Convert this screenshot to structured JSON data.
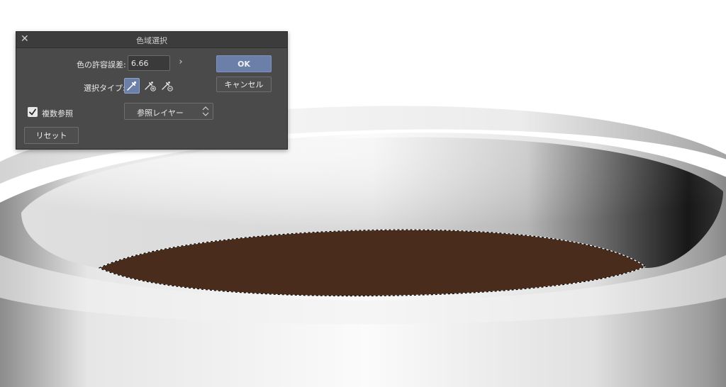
{
  "dialog": {
    "title": "色域選択",
    "tolerance_label": "色の許容誤差:",
    "tolerance_value": "6.66",
    "ok_label": "OK",
    "cancel_label": "キャンセル",
    "select_type_label": "選択タイプ:",
    "tools": [
      {
        "name": "new-selection",
        "icon": "eyedropper-icon",
        "active": true
      },
      {
        "name": "add-to-selection",
        "icon": "eyedropper-plus-icon",
        "active": false
      },
      {
        "name": "subtract-from-selection",
        "icon": "eyedropper-minus-icon",
        "active": false
      }
    ],
    "multi_ref_label": "複数参照",
    "multi_ref_checked": true,
    "reference_select_value": "参照レイヤー",
    "reset_label": "リセット"
  },
  "colors": {
    "dialog_bg": "#4a4a4a",
    "accent": "#6b7fa8",
    "coffee": "#4a2c1d",
    "cup": "#ffffff"
  }
}
